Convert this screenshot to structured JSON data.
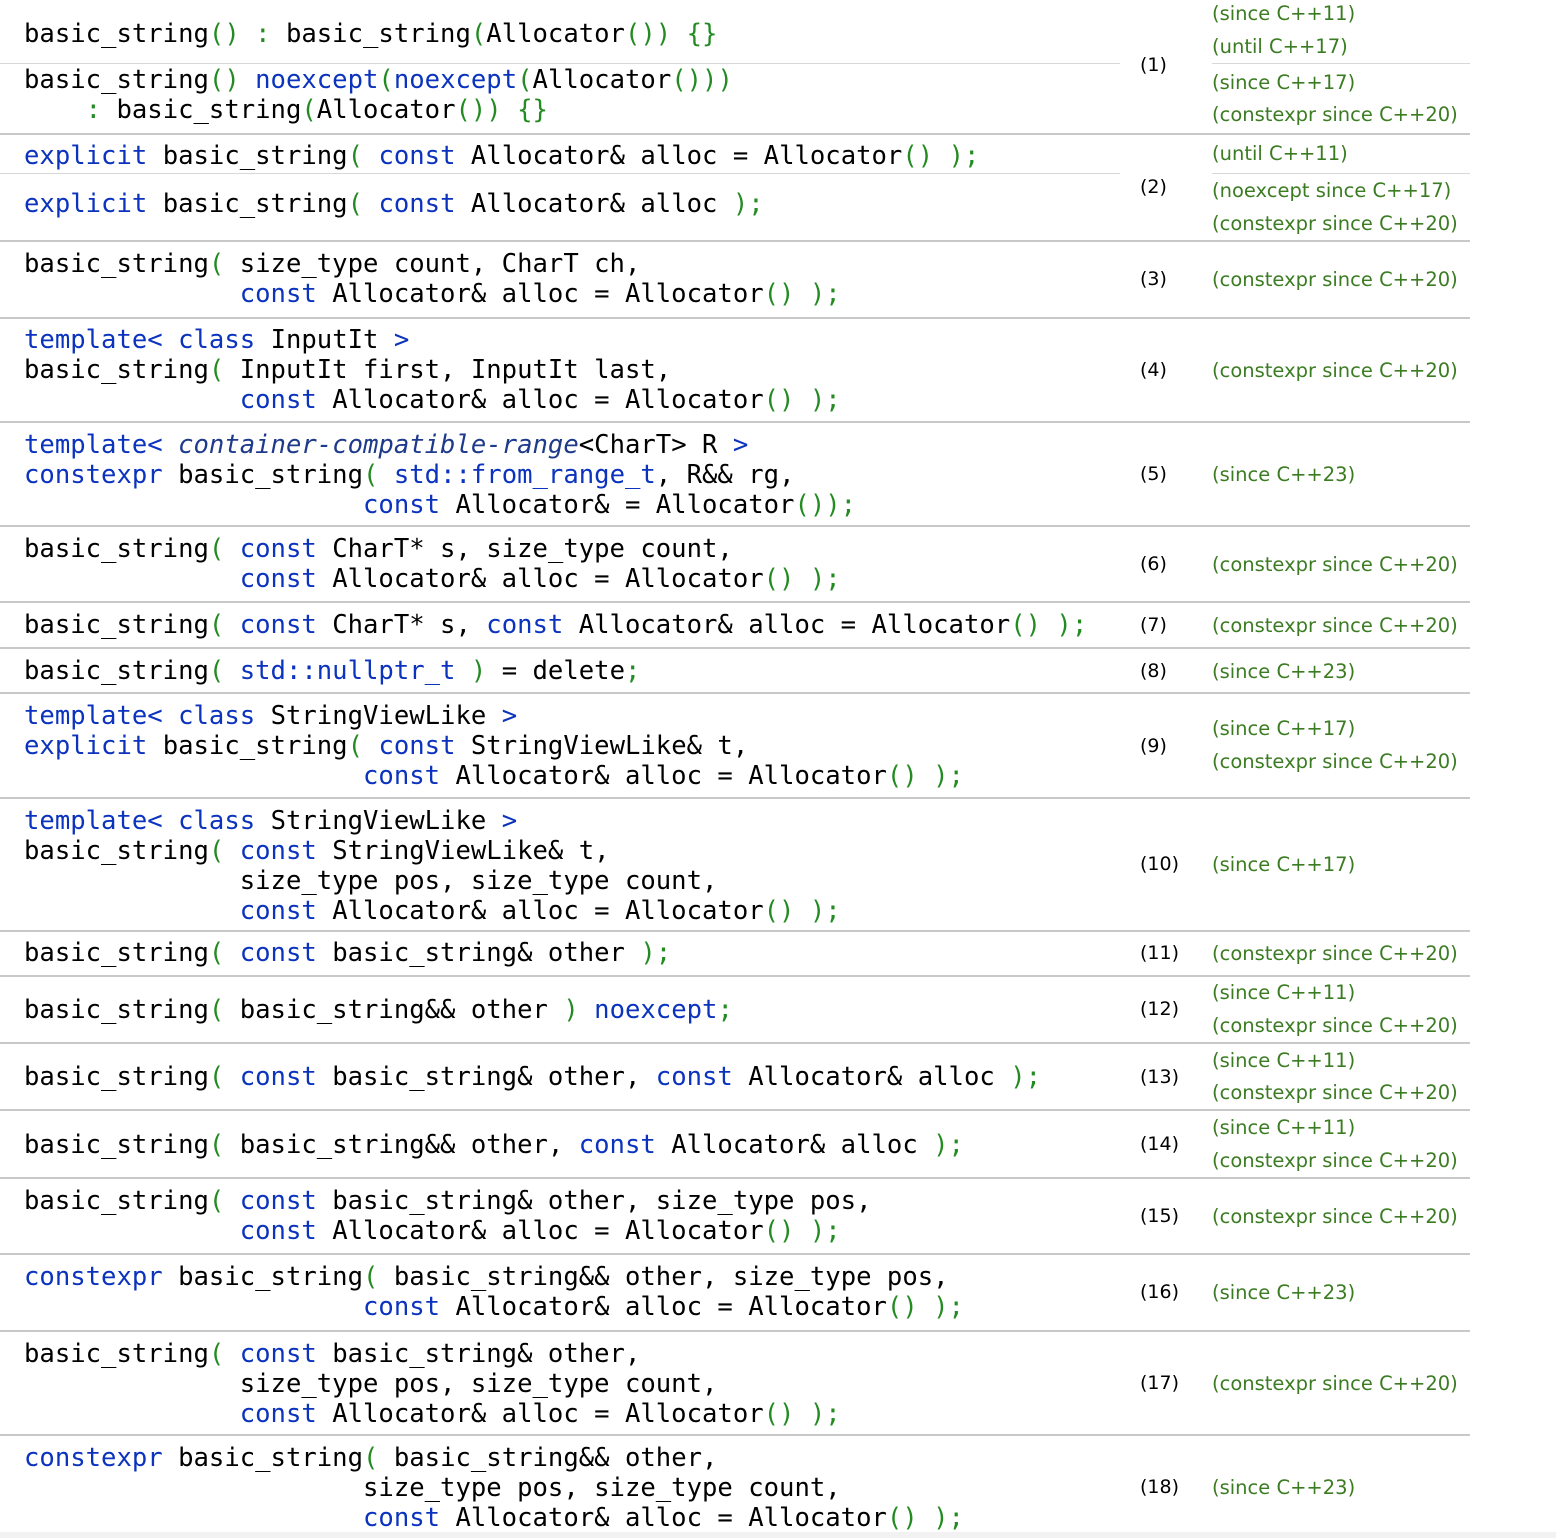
{
  "rows": [
    {
      "index": "(1)",
      "versions": [
        "(since C++11)",
        "(until C++17)",
        "(since C++17)",
        "(constexpr since C++20)"
      ]
    },
    {
      "index": "(2)",
      "versions": [
        "(until C++11)",
        "(noexcept since C++17)",
        "(constexpr since C++20)"
      ]
    },
    {
      "index": "(3)",
      "versions": [
        "(constexpr since C++20)"
      ]
    },
    {
      "index": "(4)",
      "versions": [
        "(constexpr since C++20)"
      ]
    },
    {
      "index": "(5)",
      "versions": [
        "(since C++23)"
      ]
    },
    {
      "index": "(6)",
      "versions": [
        "(constexpr since C++20)"
      ]
    },
    {
      "index": "(7)",
      "versions": [
        "(constexpr since C++20)"
      ]
    },
    {
      "index": "(8)",
      "versions": [
        "(since C++23)"
      ]
    },
    {
      "index": "(9)",
      "versions": [
        "(since C++17)",
        "(constexpr since C++20)"
      ]
    },
    {
      "index": "(10)",
      "versions": [
        "(since C++17)"
      ]
    },
    {
      "index": "(11)",
      "versions": [
        "(constexpr since C++20)"
      ]
    },
    {
      "index": "(12)",
      "versions": [
        "(since C++11)",
        "(constexpr since C++20)"
      ]
    },
    {
      "index": "(13)",
      "versions": [
        "(since C++11)",
        "(constexpr since C++20)"
      ]
    },
    {
      "index": "(14)",
      "versions": [
        "(since C++11)",
        "(constexpr since C++20)"
      ]
    },
    {
      "index": "(15)",
      "versions": [
        "(constexpr since C++20)"
      ]
    },
    {
      "index": "(16)",
      "versions": [
        "(since C++23)"
      ]
    },
    {
      "index": "(17)",
      "versions": [
        "(constexpr since C++20)"
      ]
    },
    {
      "index": "(18)",
      "versions": [
        "(since C++23)"
      ]
    }
  ],
  "code": [
    [
      [
        [
          "basic_string",
          "p"
        ],
        [
          "() : ",
          "s"
        ],
        [
          "basic_string",
          "p"
        ],
        [
          "(",
          "s"
        ],
        [
          "Allocator",
          "p"
        ],
        [
          "()) {}",
          "s"
        ]
      ]
    ],
    [
      [
        [
          "basic_string",
          "p"
        ],
        [
          "() ",
          "s"
        ],
        [
          "noexcept",
          "k"
        ],
        [
          "(",
          "s"
        ],
        [
          "noexcept",
          "k"
        ],
        [
          "(",
          "s"
        ],
        [
          "Allocator",
          "p"
        ],
        [
          "()))",
          "s"
        ]
      ],
      [
        [
          "    ",
          "p"
        ],
        [
          ": ",
          "s"
        ],
        [
          "basic_string",
          "p"
        ],
        [
          "(",
          "s"
        ],
        [
          "Allocator",
          "p"
        ],
        [
          "()) {}",
          "s"
        ]
      ]
    ],
    [
      [
        [
          "explicit",
          "k"
        ],
        [
          " basic_string",
          "p"
        ],
        [
          "( ",
          "s"
        ],
        [
          "const",
          "k"
        ],
        [
          " Allocator& alloc = Allocator",
          "p"
        ],
        [
          "() );",
          "s"
        ]
      ]
    ],
    [
      [
        [
          "explicit",
          "k"
        ],
        [
          " basic_string",
          "p"
        ],
        [
          "( ",
          "s"
        ],
        [
          "const",
          "k"
        ],
        [
          " Allocator& alloc ",
          "p"
        ],
        [
          ");",
          "s"
        ]
      ]
    ],
    [
      [
        [
          "basic_string",
          "p"
        ],
        [
          "( ",
          "s"
        ],
        [
          "size_type count, CharT ch,",
          "p"
        ]
      ],
      [
        [
          "              ",
          "p"
        ],
        [
          "const",
          "k"
        ],
        [
          " Allocator& alloc = Allocator",
          "p"
        ],
        [
          "() );",
          "s"
        ]
      ]
    ],
    [
      [
        [
          "template",
          "k"
        ],
        [
          "< ",
          "k"
        ],
        [
          "class",
          "k"
        ],
        [
          " InputIt ",
          "p"
        ],
        [
          ">",
          "k"
        ]
      ],
      [
        [
          "basic_string",
          "p"
        ],
        [
          "( ",
          "s"
        ],
        [
          "InputIt first, InputIt last,",
          "p"
        ]
      ],
      [
        [
          "              ",
          "p"
        ],
        [
          "const",
          "k"
        ],
        [
          " Allocator& alloc = Allocator",
          "p"
        ],
        [
          "() );",
          "s"
        ]
      ]
    ],
    [
      [
        [
          "template",
          "k"
        ],
        [
          "< ",
          "k"
        ],
        [
          "container-compatible-range",
          "i"
        ],
        [
          "<CharT> R ",
          "p"
        ],
        [
          ">",
          "k"
        ]
      ],
      [
        [
          "constexpr",
          "k"
        ],
        [
          " basic_string",
          "p"
        ],
        [
          "( ",
          "s"
        ],
        [
          "std::from_range_t",
          "k"
        ],
        [
          ", R&& rg,",
          "p"
        ]
      ],
      [
        [
          "                      ",
          "p"
        ],
        [
          "const",
          "k"
        ],
        [
          " Allocator& = Allocator",
          "p"
        ],
        [
          "());",
          "s"
        ]
      ]
    ],
    [
      [
        [
          "basic_string",
          "p"
        ],
        [
          "( ",
          "s"
        ],
        [
          "const",
          "k"
        ],
        [
          " CharT* s, size_type count,",
          "p"
        ]
      ],
      [
        [
          "              ",
          "p"
        ],
        [
          "const",
          "k"
        ],
        [
          " Allocator& alloc = Allocator",
          "p"
        ],
        [
          "() );",
          "s"
        ]
      ]
    ],
    [
      [
        [
          "basic_string",
          "p"
        ],
        [
          "( ",
          "s"
        ],
        [
          "const",
          "k"
        ],
        [
          " CharT* s, ",
          "p"
        ],
        [
          "const",
          "k"
        ],
        [
          " Allocator& alloc = Allocator",
          "p"
        ],
        [
          "() );",
          "s"
        ]
      ]
    ],
    [
      [
        [
          "basic_string",
          "p"
        ],
        [
          "( ",
          "s"
        ],
        [
          "std::nullptr_t",
          "k"
        ],
        [
          " ) ",
          "s"
        ],
        [
          "= delete",
          "p"
        ],
        [
          ";",
          "s"
        ]
      ]
    ],
    [
      [
        [
          "template",
          "k"
        ],
        [
          "< ",
          "k"
        ],
        [
          "class",
          "k"
        ],
        [
          " StringViewLike ",
          "p"
        ],
        [
          ">",
          "k"
        ]
      ],
      [
        [
          "explicit",
          "k"
        ],
        [
          " basic_string",
          "p"
        ],
        [
          "( ",
          "s"
        ],
        [
          "const",
          "k"
        ],
        [
          " StringViewLike& t,",
          "p"
        ]
      ],
      [
        [
          "                      ",
          "p"
        ],
        [
          "const",
          "k"
        ],
        [
          " Allocator& alloc = Allocator",
          "p"
        ],
        [
          "() );",
          "s"
        ]
      ]
    ],
    [
      [
        [
          "template",
          "k"
        ],
        [
          "< ",
          "k"
        ],
        [
          "class",
          "k"
        ],
        [
          " StringViewLike ",
          "p"
        ],
        [
          ">",
          "k"
        ]
      ],
      [
        [
          "basic_string",
          "p"
        ],
        [
          "( ",
          "s"
        ],
        [
          "const",
          "k"
        ],
        [
          " StringViewLike& t,",
          "p"
        ]
      ],
      [
        [
          "              ",
          "p"
        ],
        [
          "size_type pos, size_type count,",
          "p"
        ]
      ],
      [
        [
          "              ",
          "p"
        ],
        [
          "const",
          "k"
        ],
        [
          " Allocator& alloc = Allocator",
          "p"
        ],
        [
          "() );",
          "s"
        ]
      ]
    ],
    [
      [
        [
          "basic_string",
          "p"
        ],
        [
          "( ",
          "s"
        ],
        [
          "const",
          "k"
        ],
        [
          " basic_string& other ",
          "p"
        ],
        [
          ");",
          "s"
        ]
      ]
    ],
    [
      [
        [
          "basic_string",
          "p"
        ],
        [
          "( ",
          "s"
        ],
        [
          "basic_string&& other ",
          "p"
        ],
        [
          ") ",
          "s"
        ],
        [
          "noexcept",
          "k"
        ],
        [
          ";",
          "s"
        ]
      ]
    ],
    [
      [
        [
          "basic_string",
          "p"
        ],
        [
          "( ",
          "s"
        ],
        [
          "const",
          "k"
        ],
        [
          " basic_string& other, ",
          "p"
        ],
        [
          "const",
          "k"
        ],
        [
          " Allocator& alloc ",
          "p"
        ],
        [
          ");",
          "s"
        ]
      ]
    ],
    [
      [
        [
          "basic_string",
          "p"
        ],
        [
          "( ",
          "s"
        ],
        [
          "basic_string&& other, ",
          "p"
        ],
        [
          "const",
          "k"
        ],
        [
          " Allocator& alloc ",
          "p"
        ],
        [
          ");",
          "s"
        ]
      ]
    ],
    [
      [
        [
          "basic_string",
          "p"
        ],
        [
          "( ",
          "s"
        ],
        [
          "const",
          "k"
        ],
        [
          " basic_string& other, size_type pos,",
          "p"
        ]
      ],
      [
        [
          "              ",
          "p"
        ],
        [
          "const",
          "k"
        ],
        [
          " Allocator& alloc = Allocator",
          "p"
        ],
        [
          "() );",
          "s"
        ]
      ]
    ],
    [
      [
        [
          "constexpr",
          "k"
        ],
        [
          " basic_string",
          "p"
        ],
        [
          "( ",
          "s"
        ],
        [
          "basic_string&& other, size_type pos,",
          "p"
        ]
      ],
      [
        [
          "                      ",
          "p"
        ],
        [
          "const",
          "k"
        ],
        [
          " Allocator& alloc = Allocator",
          "p"
        ],
        [
          "() );",
          "s"
        ]
      ]
    ],
    [
      [
        [
          "basic_string",
          "p"
        ],
        [
          "( ",
          "s"
        ],
        [
          "const",
          "k"
        ],
        [
          " basic_string& other,",
          "p"
        ]
      ],
      [
        [
          "              ",
          "p"
        ],
        [
          "size_type pos, size_type count,",
          "p"
        ]
      ],
      [
        [
          "              ",
          "p"
        ],
        [
          "const",
          "k"
        ],
        [
          " Allocator& alloc = Allocator",
          "p"
        ],
        [
          "() );",
          "s"
        ]
      ]
    ],
    [
      [
        [
          "constexpr",
          "k"
        ],
        [
          " basic_string",
          "p"
        ],
        [
          "( ",
          "s"
        ],
        [
          "basic_string&& other,",
          "p"
        ]
      ],
      [
        [
          "                      ",
          "p"
        ],
        [
          "size_type pos, size_type count,",
          "p"
        ]
      ],
      [
        [
          "                      ",
          "p"
        ],
        [
          "const",
          "k"
        ],
        [
          " Allocator& alloc = Allocator",
          "p"
        ],
        [
          "() );",
          "s"
        ]
      ]
    ]
  ],
  "colors": {
    "keyword": "#0b33bd",
    "symbol": "#238b22",
    "version": "#3b7c22",
    "divider": "#c8c8c8"
  }
}
